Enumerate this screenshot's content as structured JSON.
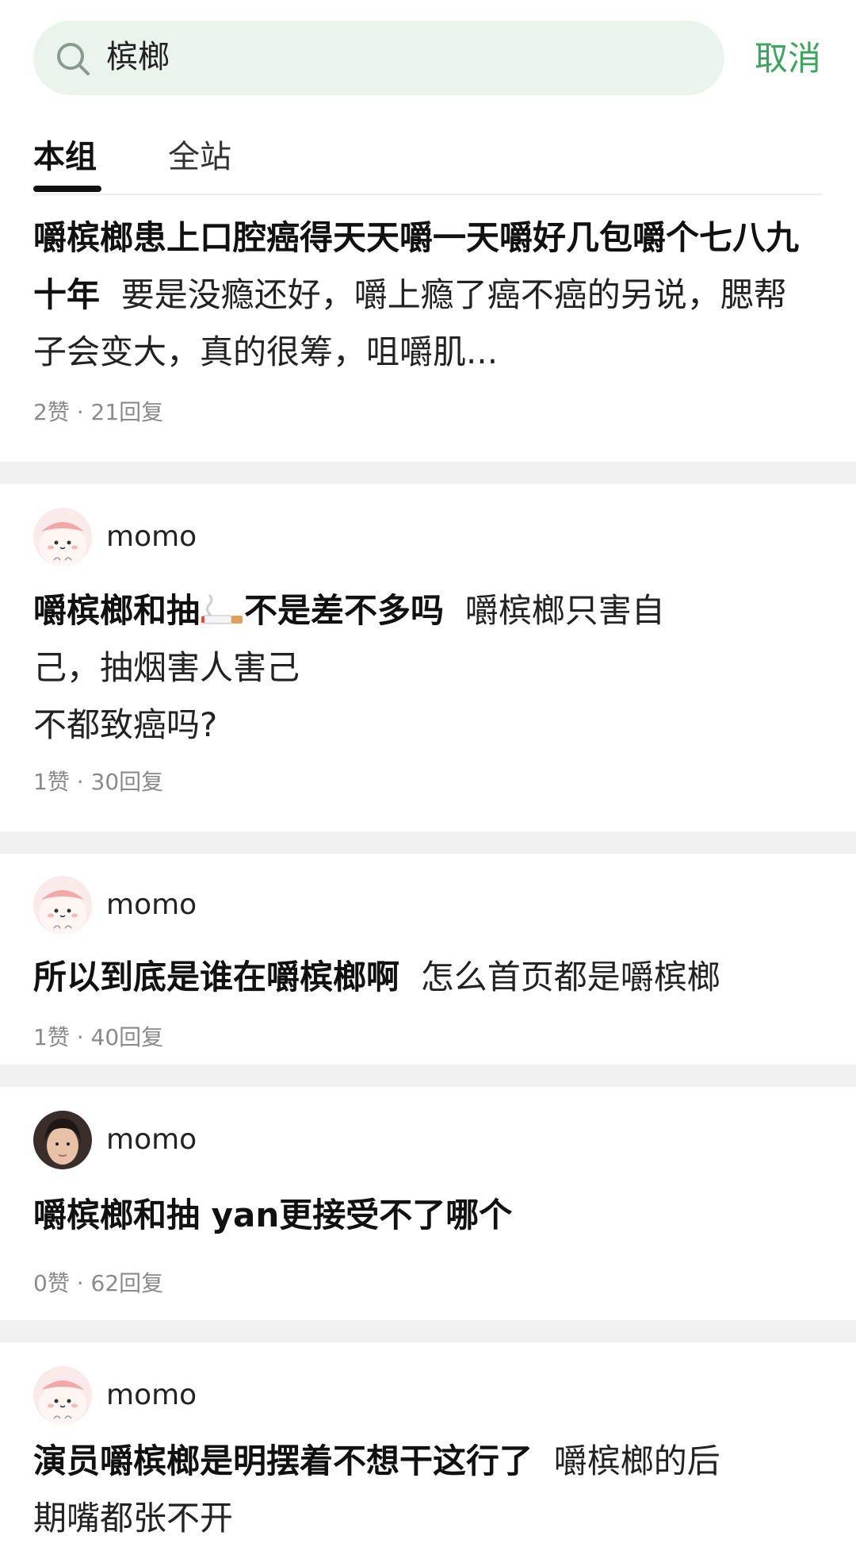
{
  "search": {
    "query": "槟榔",
    "cancel_label": "取消"
  },
  "tabs": [
    {
      "label": "本组",
      "active": true
    },
    {
      "label": "全站",
      "active": false
    }
  ],
  "posts": [
    {
      "title": "嚼槟榔患上口腔癌得天天嚼一天嚼好几包嚼个七八九十年",
      "excerpt": "要是没瘾还好，嚼上瘾了癌不癌的另说，腮帮子会变大，真的很筹，咀嚼肌...",
      "meta": "2赞 · 21回复"
    },
    {
      "author": "momo",
      "avatar": "pink-cartoon-avatar",
      "title_part1": "嚼槟榔和抽",
      "title_icon": "cigarette-emoji",
      "title_part2": "不是差不多吗",
      "excerpt_line1": "嚼槟榔只害自",
      "excerpt_line2": "己，抽烟害人害己",
      "excerpt_line3": "不都致癌吗?",
      "meta": "1赞 · 30回复"
    },
    {
      "author": "momo",
      "avatar": "pink-cartoon-avatar",
      "title": "所以到底是谁在嚼槟榔啊",
      "excerpt": "怎么首页都是嚼槟榔",
      "meta": "1赞 · 40回复"
    },
    {
      "author": "momo",
      "avatar": "photo-avatar",
      "title": "嚼槟榔和抽 yan更接受不了哪个",
      "meta": "0赞 · 62回复"
    },
    {
      "author": "momo",
      "avatar": "pink-cartoon-avatar",
      "title": "演员嚼槟榔是明摆着不想干这行了",
      "excerpt_line1": "嚼槟榔的后",
      "excerpt_line2": "期嘴都张不开"
    }
  ],
  "colors": {
    "accent": "#3ba55c",
    "search_bg": "#eaf3ec",
    "separator": "#f0f0f0",
    "meta_text": "#8a8a8a"
  }
}
